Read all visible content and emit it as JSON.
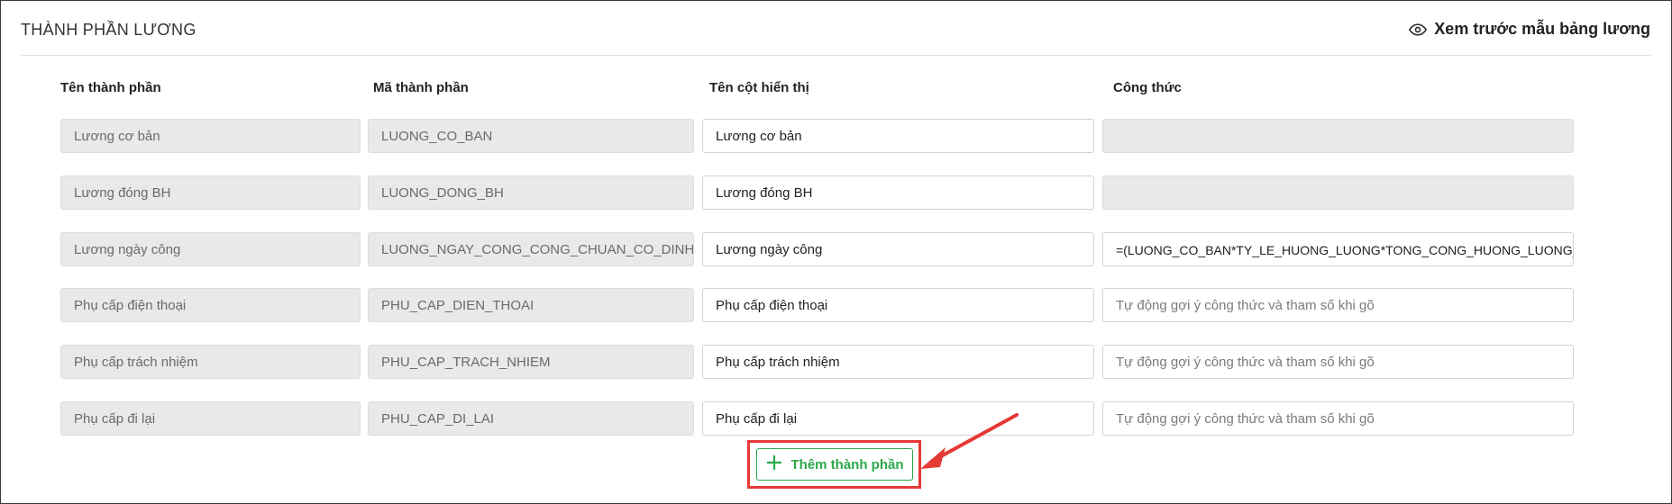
{
  "header": {
    "title": "THÀNH PHẦN LƯƠNG",
    "preview_label": "Xem trước mẫu bảng lương",
    "preview_icon": "eye-icon"
  },
  "columns": {
    "name": "Tên thành phần",
    "code": "Mã thành phần",
    "display": "Tên cột hiển thị",
    "formula": "Công thức"
  },
  "rows": [
    {
      "name": "Lương cơ bản",
      "code": "LUONG_CO_BAN",
      "display": "Lương cơ bản",
      "formula": "",
      "formula_placeholder": "",
      "formula_editable": false
    },
    {
      "name": "Lương đóng BH",
      "code": "LUONG_DONG_BH",
      "display": "Lương đóng BH",
      "formula": "",
      "formula_placeholder": "",
      "formula_editable": false
    },
    {
      "name": "Lương ngày công",
      "code": "LUONG_NGAY_CONG_CONG_CHUAN_CO_DINH",
      "display": "Lương ngày công",
      "formula": "=(LUONG_CO_BAN*TY_LE_HUONG_LUONG*TONG_CONG_HUONG_LUONG_C",
      "formula_placeholder": "",
      "formula_editable": true
    },
    {
      "name": "Phụ cấp điện thoại",
      "code": "PHU_CAP_DIEN_THOAI",
      "display": "Phụ cấp điện thoại",
      "formula": "",
      "formula_placeholder": "Tự động gợi ý công thức và tham số khi gõ",
      "formula_editable": true
    },
    {
      "name": "Phụ cấp trách nhiệm",
      "code": "PHU_CAP_TRACH_NHIEM",
      "display": "Phụ cấp trách nhiệm",
      "formula": "",
      "formula_placeholder": "Tự động gợi ý công thức và tham số khi gõ",
      "formula_editable": true
    },
    {
      "name": "Phụ cấp đi lại",
      "code": "PHU_CAP_DI_LAI",
      "display": "Phụ cấp đi lại",
      "formula": "",
      "formula_placeholder": "Tự động gợi ý công thức và tham số khi gõ",
      "formula_editable": true
    }
  ],
  "add_button": {
    "label": "Thêm thành phần",
    "icon": "plus-icon"
  },
  "colors": {
    "accent_green": "#2aa84a",
    "highlight_red": "#e53935",
    "readonly_bg": "#e9e9ec"
  }
}
